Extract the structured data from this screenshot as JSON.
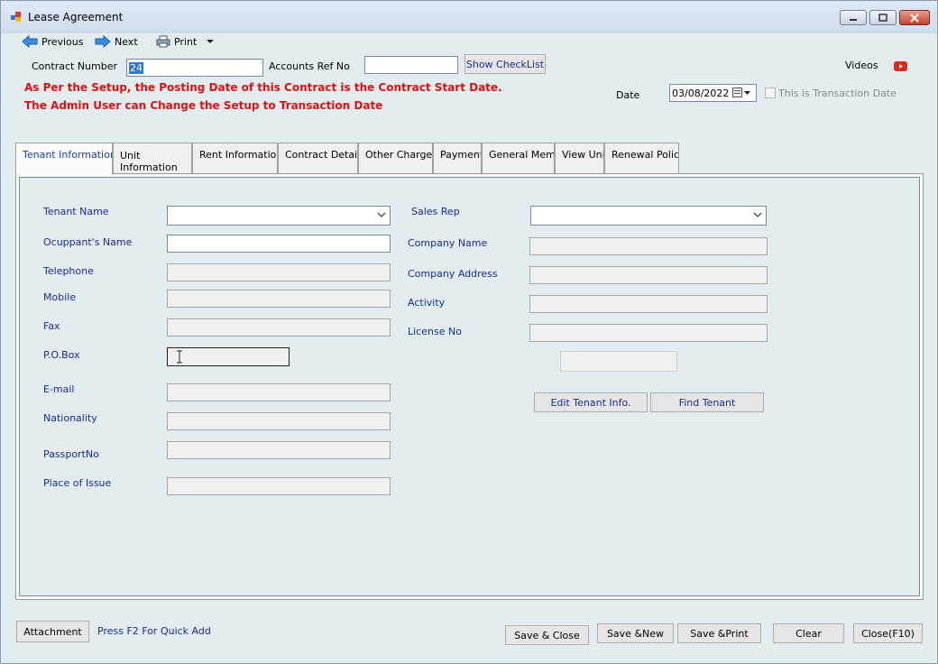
{
  "window": {
    "title": "Lease Agreement"
  },
  "toolbar": {
    "previous": "Previous",
    "next": "Next",
    "print": "Print"
  },
  "header": {
    "contract_number_label": "Contract Number",
    "contract_number_value": "24",
    "accounts_ref_label": "Accounts Ref No",
    "accounts_ref_value": "",
    "show_checklist": "Show CheckList",
    "videos_label": "Videos",
    "notice_line1": "As Per the Setup, the Posting Date of this Contract is the Contract Start Date.",
    "notice_line2": "The Admin User can Change the Setup to Transaction Date",
    "date_label": "Date",
    "date_value": "03/08/2022",
    "transaction_date_label": "This is Transaction Date"
  },
  "tabs": [
    {
      "label": "Tenant Information"
    },
    {
      "label": "Unit\nInformation"
    },
    {
      "label": "Rent Information"
    },
    {
      "label": "Contract Details"
    },
    {
      "label": "Other Charges"
    },
    {
      "label": "Payment"
    },
    {
      "label": "General Memo"
    },
    {
      "label": "View Unit"
    },
    {
      "label": "Renewal Policy"
    }
  ],
  "tenant": {
    "tenant_name": "Tenant Name",
    "occupant_name": "Ocuppant's Name",
    "telephone": "Telephone",
    "mobile": "Mobile",
    "fax": "Fax",
    "po_box": "P.O.Box",
    "email": "E-mail",
    "nationality": "Nationality",
    "passport_no": "PassportNo",
    "place_of_issue": "Place of Issue",
    "sales_rep": "Sales Rep",
    "company_name": "Company Name",
    "company_address": "Company Address",
    "activity": "Activity",
    "license_no": "License No",
    "edit_tenant": "Edit Tenant Info.",
    "find_tenant": "Find Tenant"
  },
  "footer": {
    "attachment": "Attachment",
    "quick_add_hint": "Press F2 For Quick Add",
    "save_close": "Save & Close",
    "save_new": "Save &New",
    "save_print": "Save &Print",
    "clear": "Clear",
    "close": "Close(F10)"
  },
  "colors": {
    "notice_red": "#e01010",
    "label_blue": "#1a2a9a",
    "active_tab_text": "#1f3ea8"
  }
}
